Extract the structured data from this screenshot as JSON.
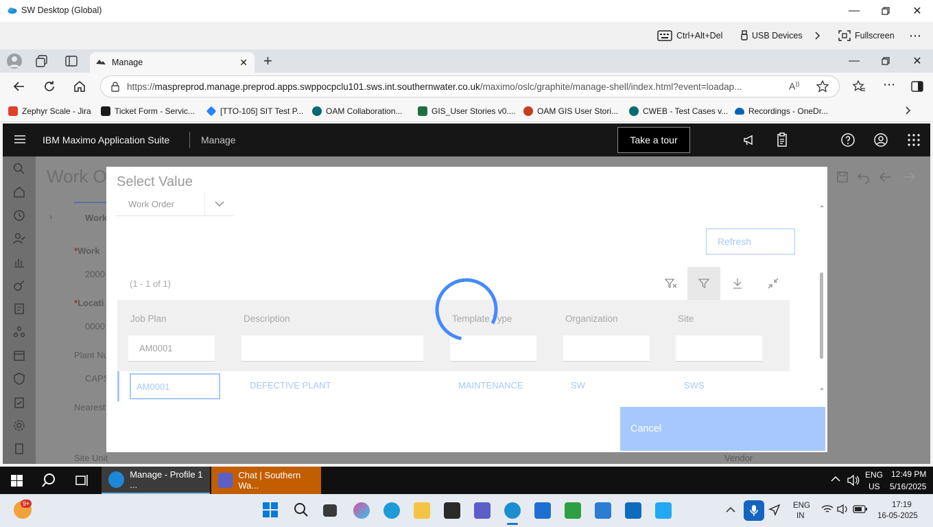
{
  "rd": {
    "title": "SW Desktop (Global)",
    "toolbar": {
      "ctrl_alt_del": "Ctrl+Alt+Del",
      "usb": "USB Devices",
      "fullscreen": "Fullscreen"
    }
  },
  "browser": {
    "tab_label": "Manage",
    "url_prefix": "https://",
    "url_host": "maspreprod.manage.preprod.apps.swppocpclu101.sws.int.southernwater.co.uk",
    "url_path": "/maximo/oslc/graphite/manage-shell/index.html?event=loadap...",
    "bookmarks": [
      {
        "label": "Zephyr Scale - Jira",
        "color": "#e0402b"
      },
      {
        "label": "Ticket Form - Servic...",
        "color": "#1a1a1a"
      },
      {
        "label": "[TTO-105] SIT Test P...",
        "color": "#2684ff"
      },
      {
        "label": "OAM Collaboration...",
        "color": "#036c70"
      },
      {
        "label": "GIS_User Stories v0....",
        "color": "#1d6f42"
      },
      {
        "label": "OAM GIS User Stori...",
        "color": "#c43e1c"
      },
      {
        "label": "CWEB - Test Cases v...",
        "color": "#036c70"
      },
      {
        "label": "Recordings - OneDr...",
        "color": "#0364b8"
      }
    ]
  },
  "app": {
    "brand": "IBM Maximo Application Suite",
    "module": "Manage",
    "tour_button": "Take a tour",
    "bg": {
      "page_title": "Work O",
      "tab_label": "Work",
      "work_label": "Work",
      "work_value": "2000",
      "location_label": "Locati",
      "location_value": "0000",
      "plant_label": "Plant Nu",
      "plant_value": "CAPS",
      "nearest_label": "Nearest",
      "site_unit_label": "Site Unit",
      "vendor_label": "Vendor"
    }
  },
  "dialog": {
    "title": "Select Value",
    "object_select": "Work Order",
    "refresh_label": "Refresh",
    "row_count": "(1 - 1 of 1)",
    "columns": [
      "Job Plan",
      "Description",
      "Template Type",
      "Organization",
      "Site"
    ],
    "filter_values": [
      "AM0001",
      "",
      "",
      "",
      ""
    ],
    "rows": [
      {
        "job_plan": "AM0001",
        "description": "DEFECTIVE PLANT",
        "template_type": "MAINTENANCE",
        "organization": "SW",
        "site": "SWS"
      }
    ],
    "cancel_label": "Cancel"
  },
  "remote_taskbar": {
    "apps": [
      {
        "label": "Manage - Profile 1 ..."
      },
      {
        "label": "Chat | Southern Wa..."
      }
    ],
    "lang1": "ENG",
    "lang2": "US",
    "time": "12:49 PM",
    "date": "5/16/2025"
  },
  "local_taskbar": {
    "badge": "9+",
    "lang1": "ENG",
    "lang2": "IN",
    "time": "17:19",
    "date": "16-05-2025"
  }
}
